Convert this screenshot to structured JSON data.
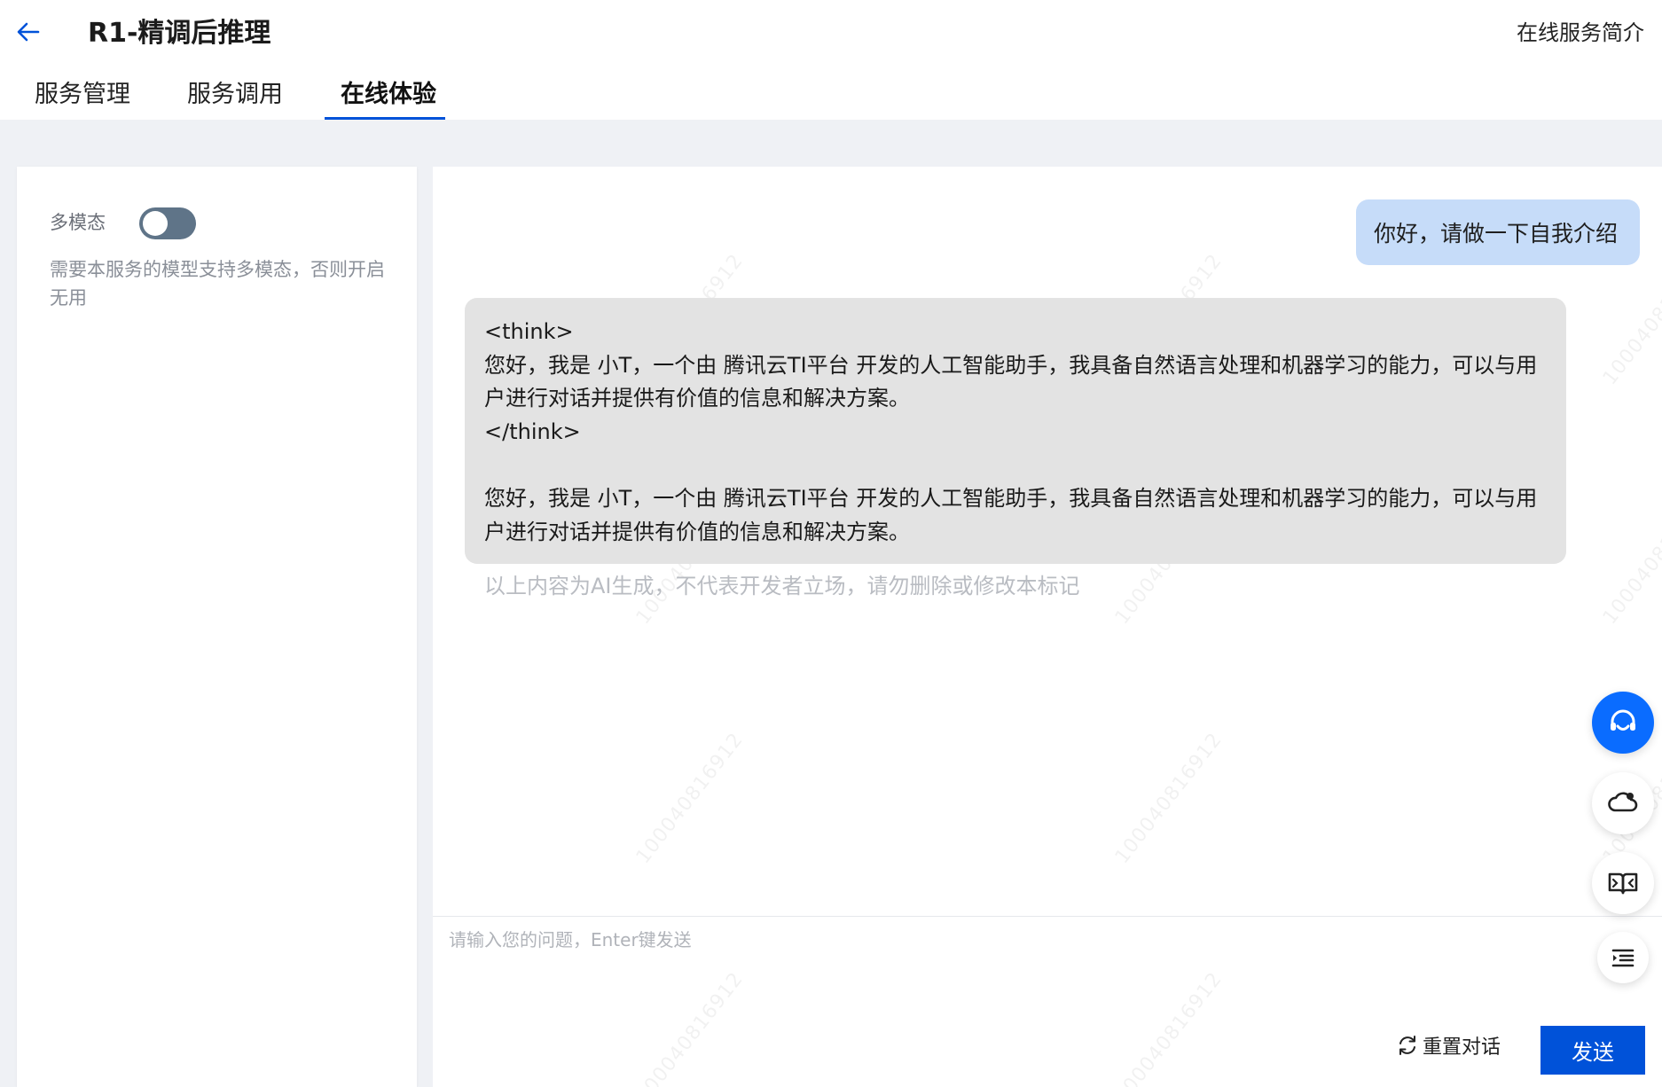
{
  "header": {
    "title": "R1-精调后推理",
    "intro_link": "在线服务简介",
    "tabs": [
      {
        "label": "服务管理"
      },
      {
        "label": "服务调用"
      },
      {
        "label": "在线体验"
      }
    ]
  },
  "settings": {
    "multimodal_label": "多模态",
    "multimodal_enabled": false,
    "multimodal_desc": "需要本服务的模型支持多模态，否则开启无用"
  },
  "chat": {
    "user_message": "你好，请做一下自我介绍",
    "bot_message": "<think>\n您好，我是 小T，一个由 腾讯云TI平台 开发的人工智能助手，我具备自然语言处理和机器学习的能力，可以与用户进行对话并提供有价值的信息和解决方案。\n</think>\n\n您好，我是 小T，一个由 腾讯云TI平台 开发的人工智能助手，我具备自然语言处理和机器学习的能力，可以与用户进行对话并提供有价值的信息和解决方案。",
    "disclaimer": "以上内容为AI生成，不代表开发者立场，请勿删除或修改本标记",
    "watermark": "100040816912"
  },
  "input": {
    "placeholder": "请输入您的问题，Enter键发送",
    "value": "",
    "reset_label": "重置对话",
    "send_label": "发送"
  },
  "colors": {
    "accent": "#0052d9",
    "user_bubble": "#c6dcf9",
    "bot_bubble": "#e3e3e3",
    "toggle_off": "#5f7488"
  },
  "floating_buttons": [
    "headset-icon",
    "cloud-alert-icon",
    "book-icon",
    "list-indent-icon"
  ]
}
